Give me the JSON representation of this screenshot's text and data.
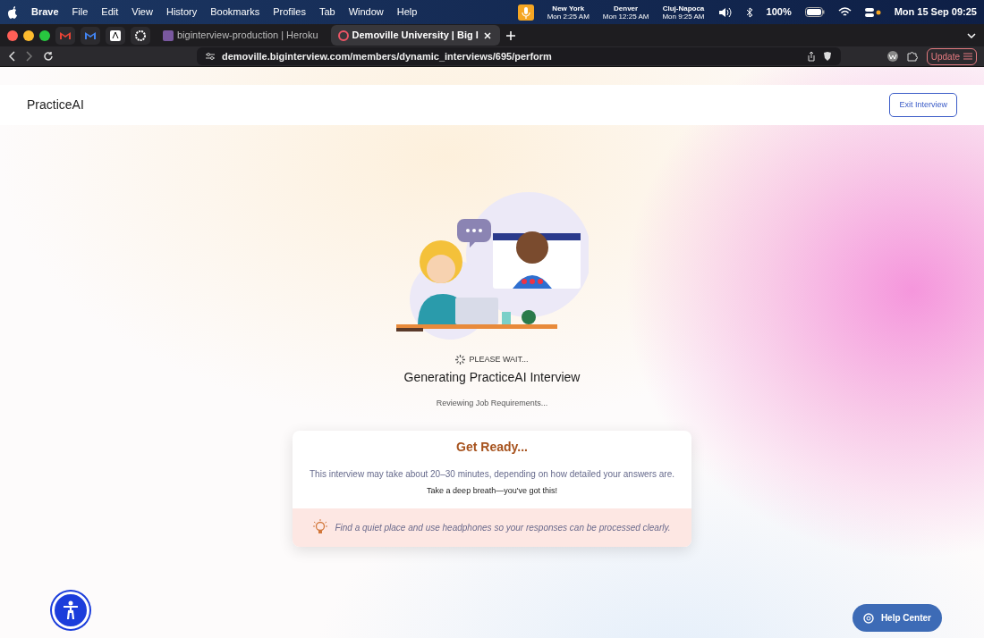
{
  "menu_bar": {
    "items": [
      "Brave",
      "File",
      "Edit",
      "View",
      "History",
      "Bookmarks",
      "Profiles",
      "Tab",
      "Window",
      "Help"
    ],
    "clocks": [
      {
        "city": "New York",
        "time": "Mon 2:25 AM"
      },
      {
        "city": "Denver",
        "time": "Mon 12:25 AM"
      },
      {
        "city": "Cluj-Napoca",
        "time": "Mon 9:25 AM"
      }
    ],
    "battery": "100%",
    "datetime": "Mon 15 Sep  09:25"
  },
  "browser": {
    "tabs": [
      {
        "title": "biginterview-production | Heroku",
        "selected": false
      },
      {
        "title": "Demoville University | Big I",
        "selected": true
      }
    ],
    "url": "demoville.biginterview.com/members/dynamic_interviews/695/perform",
    "update_button": "Update"
  },
  "page": {
    "brand": "PracticeAI",
    "exit_button": "Exit Interview",
    "status": "PLEASE WAIT...",
    "heading": "Generating PracticeAI Interview",
    "substatus": "Reviewing Job Requirements...",
    "card": {
      "title": "Get Ready...",
      "body": "This interview may take about 20–30 minutes, depending on how detailed your answers are.",
      "encouragement": "Take a deep breath—you've got this!",
      "tip": "Find a quiet place and use headphones so your responses can be processed clearly."
    },
    "help_button": "Help Center"
  }
}
